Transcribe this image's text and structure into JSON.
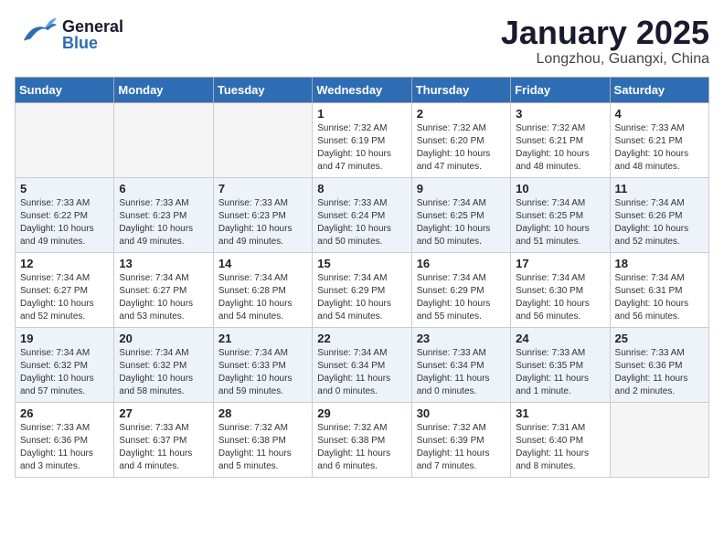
{
  "header": {
    "logo_general": "General",
    "logo_blue": "Blue",
    "title": "January 2025",
    "subtitle": "Longzhou, Guangxi, China"
  },
  "days_of_week": [
    "Sunday",
    "Monday",
    "Tuesday",
    "Wednesday",
    "Thursday",
    "Friday",
    "Saturday"
  ],
  "weeks": [
    [
      {
        "day": "",
        "info": ""
      },
      {
        "day": "",
        "info": ""
      },
      {
        "day": "",
        "info": ""
      },
      {
        "day": "1",
        "info": "Sunrise: 7:32 AM\nSunset: 6:19 PM\nDaylight: 10 hours\nand 47 minutes."
      },
      {
        "day": "2",
        "info": "Sunrise: 7:32 AM\nSunset: 6:20 PM\nDaylight: 10 hours\nand 47 minutes."
      },
      {
        "day": "3",
        "info": "Sunrise: 7:32 AM\nSunset: 6:21 PM\nDaylight: 10 hours\nand 48 minutes."
      },
      {
        "day": "4",
        "info": "Sunrise: 7:33 AM\nSunset: 6:21 PM\nDaylight: 10 hours\nand 48 minutes."
      }
    ],
    [
      {
        "day": "5",
        "info": "Sunrise: 7:33 AM\nSunset: 6:22 PM\nDaylight: 10 hours\nand 49 minutes."
      },
      {
        "day": "6",
        "info": "Sunrise: 7:33 AM\nSunset: 6:23 PM\nDaylight: 10 hours\nand 49 minutes."
      },
      {
        "day": "7",
        "info": "Sunrise: 7:33 AM\nSunset: 6:23 PM\nDaylight: 10 hours\nand 49 minutes."
      },
      {
        "day": "8",
        "info": "Sunrise: 7:33 AM\nSunset: 6:24 PM\nDaylight: 10 hours\nand 50 minutes."
      },
      {
        "day": "9",
        "info": "Sunrise: 7:34 AM\nSunset: 6:25 PM\nDaylight: 10 hours\nand 50 minutes."
      },
      {
        "day": "10",
        "info": "Sunrise: 7:34 AM\nSunset: 6:25 PM\nDaylight: 10 hours\nand 51 minutes."
      },
      {
        "day": "11",
        "info": "Sunrise: 7:34 AM\nSunset: 6:26 PM\nDaylight: 10 hours\nand 52 minutes."
      }
    ],
    [
      {
        "day": "12",
        "info": "Sunrise: 7:34 AM\nSunset: 6:27 PM\nDaylight: 10 hours\nand 52 minutes."
      },
      {
        "day": "13",
        "info": "Sunrise: 7:34 AM\nSunset: 6:27 PM\nDaylight: 10 hours\nand 53 minutes."
      },
      {
        "day": "14",
        "info": "Sunrise: 7:34 AM\nSunset: 6:28 PM\nDaylight: 10 hours\nand 54 minutes."
      },
      {
        "day": "15",
        "info": "Sunrise: 7:34 AM\nSunset: 6:29 PM\nDaylight: 10 hours\nand 54 minutes."
      },
      {
        "day": "16",
        "info": "Sunrise: 7:34 AM\nSunset: 6:29 PM\nDaylight: 10 hours\nand 55 minutes."
      },
      {
        "day": "17",
        "info": "Sunrise: 7:34 AM\nSunset: 6:30 PM\nDaylight: 10 hours\nand 56 minutes."
      },
      {
        "day": "18",
        "info": "Sunrise: 7:34 AM\nSunset: 6:31 PM\nDaylight: 10 hours\nand 56 minutes."
      }
    ],
    [
      {
        "day": "19",
        "info": "Sunrise: 7:34 AM\nSunset: 6:32 PM\nDaylight: 10 hours\nand 57 minutes."
      },
      {
        "day": "20",
        "info": "Sunrise: 7:34 AM\nSunset: 6:32 PM\nDaylight: 10 hours\nand 58 minutes."
      },
      {
        "day": "21",
        "info": "Sunrise: 7:34 AM\nSunset: 6:33 PM\nDaylight: 10 hours\nand 59 minutes."
      },
      {
        "day": "22",
        "info": "Sunrise: 7:34 AM\nSunset: 6:34 PM\nDaylight: 11 hours\nand 0 minutes."
      },
      {
        "day": "23",
        "info": "Sunrise: 7:33 AM\nSunset: 6:34 PM\nDaylight: 11 hours\nand 0 minutes."
      },
      {
        "day": "24",
        "info": "Sunrise: 7:33 AM\nSunset: 6:35 PM\nDaylight: 11 hours\nand 1 minute."
      },
      {
        "day": "25",
        "info": "Sunrise: 7:33 AM\nSunset: 6:36 PM\nDaylight: 11 hours\nand 2 minutes."
      }
    ],
    [
      {
        "day": "26",
        "info": "Sunrise: 7:33 AM\nSunset: 6:36 PM\nDaylight: 11 hours\nand 3 minutes."
      },
      {
        "day": "27",
        "info": "Sunrise: 7:33 AM\nSunset: 6:37 PM\nDaylight: 11 hours\nand 4 minutes."
      },
      {
        "day": "28",
        "info": "Sunrise: 7:32 AM\nSunset: 6:38 PM\nDaylight: 11 hours\nand 5 minutes."
      },
      {
        "day": "29",
        "info": "Sunrise: 7:32 AM\nSunset: 6:38 PM\nDaylight: 11 hours\nand 6 minutes."
      },
      {
        "day": "30",
        "info": "Sunrise: 7:32 AM\nSunset: 6:39 PM\nDaylight: 11 hours\nand 7 minutes."
      },
      {
        "day": "31",
        "info": "Sunrise: 7:31 AM\nSunset: 6:40 PM\nDaylight: 11 hours\nand 8 minutes."
      },
      {
        "day": "",
        "info": ""
      }
    ]
  ]
}
